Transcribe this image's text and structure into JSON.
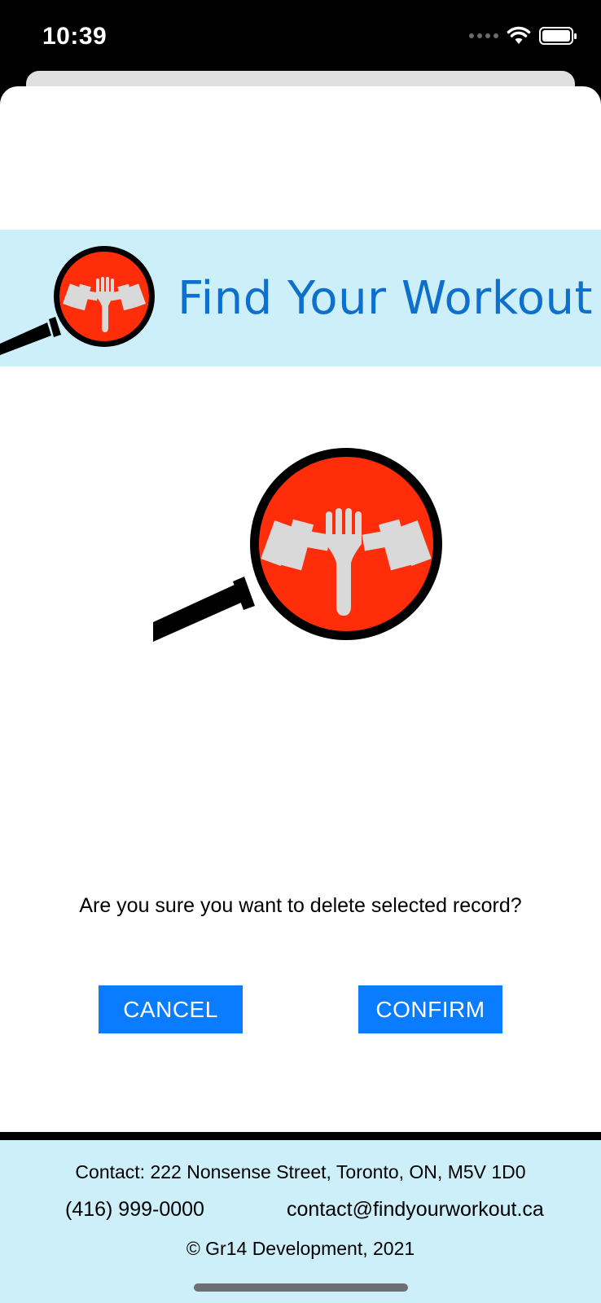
{
  "status_bar": {
    "time": "10:39"
  },
  "header": {
    "title": "Find Your Workout",
    "logo_icon": "magnifier-dumbbell-fork-icon"
  },
  "main": {
    "logo_icon": "magnifier-dumbbell-fork-icon",
    "question": "Are you sure you want to delete selected record?",
    "cancel_label": "CANCEL",
    "confirm_label": "CONFIRM"
  },
  "footer": {
    "address": "Contact: 222 Nonsense Street, Toronto, ON, M5V 1D0",
    "phone": "(416) 999-0000",
    "email": "contact@findyourworkout.ca",
    "copyright": "© Gr14 Development, 2021"
  },
  "colors": {
    "accent": "#0a7cff",
    "banner_background": "#cdeffa",
    "title_blue": "#0e6fcc",
    "logo_red": "#ff2d0a"
  }
}
